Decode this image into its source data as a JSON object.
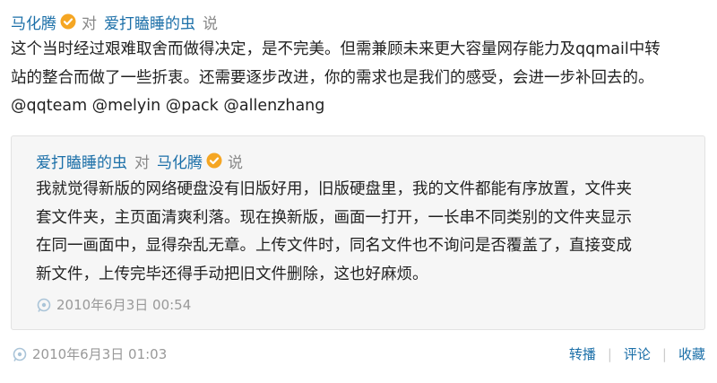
{
  "post": {
    "author": "马化腾",
    "to_word": "对",
    "target": "爱打瞌睡的虫",
    "say_word": "说",
    "text_lines": [
      "这个当时经过艰难取舍而做得决定，是不完美。但需兼顾未来更大容量网存能力及qqmail中转",
      "站的整合而做了一些折衷。还需要逐步改进，你的需求也是我们的感受，会进一步补回去的。",
      "@qqteam @melyin @pack @allenzhang"
    ],
    "timestamp": "2010年6月3日 01:03",
    "actions": [
      "转播",
      "评论",
      "收藏"
    ]
  },
  "quote": {
    "author": "爱打瞌睡的虫",
    "to_word": "对",
    "target": "马化腾",
    "say_word": "说",
    "text_lines": [
      "我就觉得新版的网络硬盘没有旧版好用，旧版硬盘里，我的文件都能有序放置，文件夹",
      "套文件夹，主页面清爽利落。现在换新版，画面一打开，一长串不同类别的文件夹显示",
      "在同一画面中，显得杂乱无章。上传文件时，同名文件也不询问是否覆盖了，直接变成",
      "新文件，上传完毕还得手动把旧文件删除，这也好麻烦。"
    ],
    "timestamp": "2010年6月3日 00:54"
  },
  "icons": {
    "verified": "verified-badge-icon",
    "time": "broadcast-time-icon"
  },
  "colors": {
    "username": "#1b6fa8",
    "verified": "#f5a623",
    "quote_bg": "#f6f6f6",
    "meta": "#999999"
  }
}
